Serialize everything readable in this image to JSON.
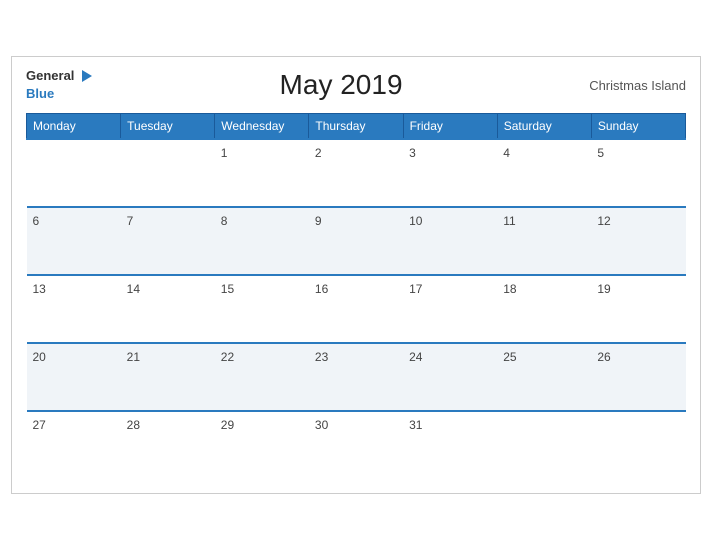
{
  "header": {
    "logo_general": "General",
    "logo_blue": "Blue",
    "title": "May 2019",
    "region": "Christmas Island"
  },
  "weekdays": [
    "Monday",
    "Tuesday",
    "Wednesday",
    "Thursday",
    "Friday",
    "Saturday",
    "Sunday"
  ],
  "weeks": [
    [
      {
        "day": ""
      },
      {
        "day": ""
      },
      {
        "day": "1"
      },
      {
        "day": "2"
      },
      {
        "day": "3"
      },
      {
        "day": "4"
      },
      {
        "day": "5"
      }
    ],
    [
      {
        "day": "6"
      },
      {
        "day": "7"
      },
      {
        "day": "8"
      },
      {
        "day": "9"
      },
      {
        "day": "10"
      },
      {
        "day": "11"
      },
      {
        "day": "12"
      }
    ],
    [
      {
        "day": "13"
      },
      {
        "day": "14"
      },
      {
        "day": "15"
      },
      {
        "day": "16"
      },
      {
        "day": "17"
      },
      {
        "day": "18"
      },
      {
        "day": "19"
      }
    ],
    [
      {
        "day": "20"
      },
      {
        "day": "21"
      },
      {
        "day": "22"
      },
      {
        "day": "23"
      },
      {
        "day": "24"
      },
      {
        "day": "25"
      },
      {
        "day": "26"
      }
    ],
    [
      {
        "day": "27"
      },
      {
        "day": "28"
      },
      {
        "day": "29"
      },
      {
        "day": "30"
      },
      {
        "day": "31"
      },
      {
        "day": ""
      },
      {
        "day": ""
      }
    ]
  ]
}
